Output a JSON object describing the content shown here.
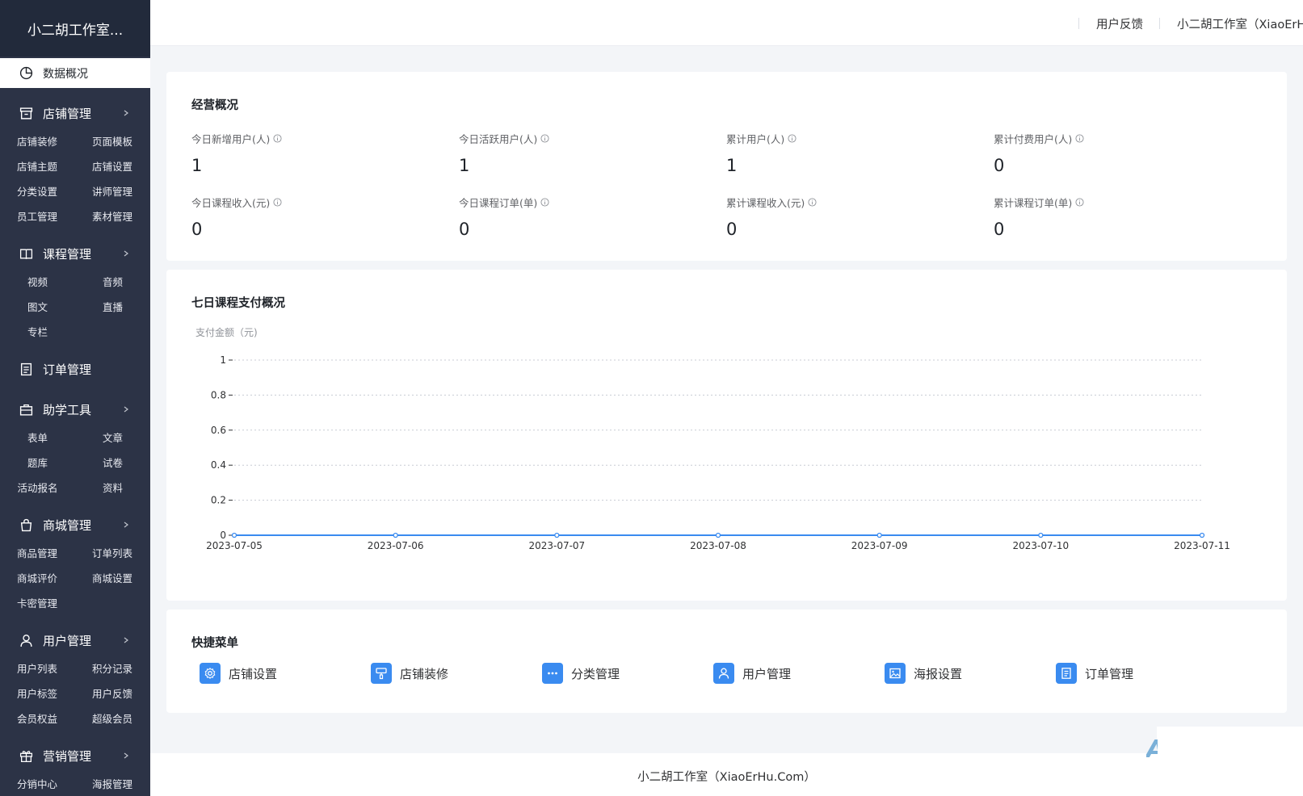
{
  "sidebar": {
    "brand": "小二胡工作室...",
    "active": "数据概况",
    "shop": {
      "label": "店铺管理",
      "items": [
        "店铺装修",
        "页面模板",
        "店铺主题",
        "店铺设置",
        "分类设置",
        "讲师管理",
        "员工管理",
        "素材管理"
      ]
    },
    "course": {
      "label": "课程管理",
      "items": [
        "视频",
        "音频",
        "图文",
        "直播",
        "专栏"
      ]
    },
    "order": {
      "label": "订单管理"
    },
    "tools": {
      "label": "助学工具",
      "items": [
        "表单",
        "文章",
        "题库",
        "试卷",
        "活动报名",
        "资料"
      ]
    },
    "mall": {
      "label": "商城管理",
      "items": [
        "商品管理",
        "订单列表",
        "商城评价",
        "商城设置",
        "卡密管理"
      ]
    },
    "users": {
      "label": "用户管理",
      "items": [
        "用户列表",
        "积分记录",
        "用户标签",
        "用户反馈",
        "会员权益",
        "超级会员"
      ]
    },
    "marketing": {
      "label": "营销管理",
      "items": [
        "分销中心",
        "海报管理"
      ]
    }
  },
  "header": {
    "feedback": "用户反馈",
    "account": "小二胡工作室（XiaoErHu.Com）"
  },
  "overview": {
    "title": "经营概况",
    "stats": [
      {
        "label": "今日新增用户(人)",
        "value": "1"
      },
      {
        "label": "今日活跃用户(人)",
        "value": "1"
      },
      {
        "label": "累计用户(人)",
        "value": "1"
      },
      {
        "label": "累计付费用户(人)",
        "value": "0"
      },
      {
        "label": "今日课程收入(元)",
        "value": "0"
      },
      {
        "label": "今日课程订单(单)",
        "value": "0"
      },
      {
        "label": "累计课程收入(元)",
        "value": "0"
      },
      {
        "label": "累计课程订单(单)",
        "value": "0"
      }
    ]
  },
  "chart_section": {
    "title": "七日课程支付概况"
  },
  "chart_data": {
    "type": "line",
    "ylabel": "支付金额（元)",
    "x": [
      "2023-07-05",
      "2023-07-06",
      "2023-07-07",
      "2023-07-08",
      "2023-07-09",
      "2023-07-10",
      "2023-07-11"
    ],
    "series": [
      {
        "values": [
          0,
          0,
          0,
          0,
          0,
          0,
          0
        ]
      }
    ],
    "yticks": [
      "0",
      "0.2",
      "0.4",
      "0.6",
      "0.8",
      "1"
    ],
    "ylim": [
      0,
      1
    ],
    "grid": true,
    "line_color": "#3a8bf0"
  },
  "quick_menu": {
    "title": "快捷菜单",
    "items": [
      {
        "label": "店铺设置",
        "icon": "gear-icon"
      },
      {
        "label": "店铺装修",
        "icon": "decorate-icon"
      },
      {
        "label": "分类管理",
        "icon": "dots-icon"
      },
      {
        "label": "用户管理",
        "icon": "user-icon"
      },
      {
        "label": "海报设置",
        "icon": "image-icon"
      },
      {
        "label": "订单管理",
        "icon": "document-icon"
      }
    ]
  },
  "footer": {
    "text": "小二胡工作室（XiaoErHu.Com）"
  },
  "colors": {
    "sidebar": "#2c3346",
    "brand_bar": "#222a3b",
    "accent": "#3a8bf0",
    "background": "#f3f5f8"
  }
}
